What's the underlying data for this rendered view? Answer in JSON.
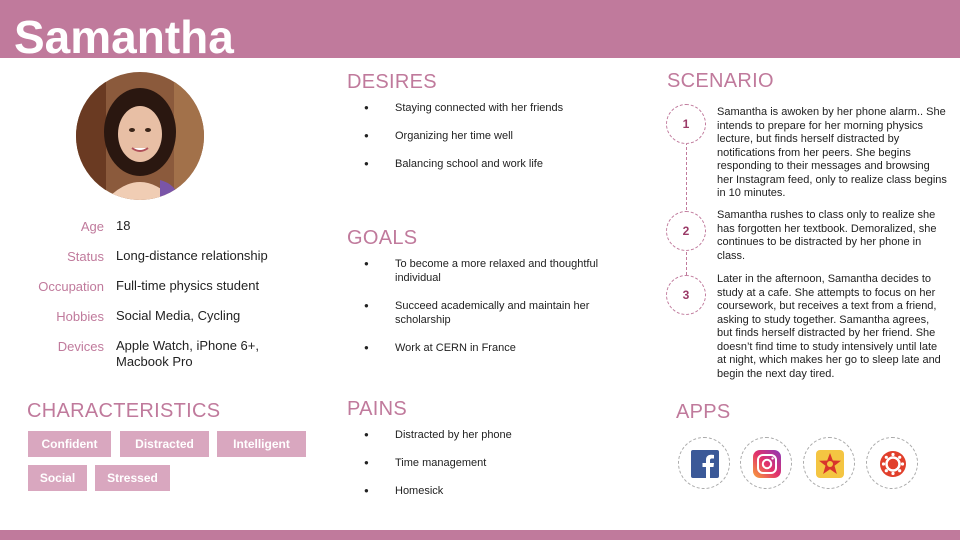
{
  "persona": {
    "name": "Samantha",
    "attributes": [
      {
        "label": "Age",
        "value": "18"
      },
      {
        "label": "Status",
        "value": "Long-distance relationship"
      },
      {
        "label": "Occupation",
        "value": "Full-time physics student"
      },
      {
        "label": "Hobbies",
        "value": "Social Media, Cycling"
      },
      {
        "label": "Devices",
        "value": "Apple Watch, iPhone 6+, Macbook Pro"
      }
    ]
  },
  "characteristics": {
    "title": "CHARACTERISTICS",
    "items": [
      "Confident",
      "Distracted",
      "Intelligent",
      "Social",
      "Stressed"
    ]
  },
  "desires": {
    "title": "DESIRES",
    "items": [
      "Staying connected with her friends",
      "Organizing her time well",
      "Balancing  school and work life"
    ]
  },
  "goals": {
    "title": "GOALS",
    "items": [
      "To become a more relaxed and thoughtful individual",
      "Succeed academically and maintain her scholarship",
      "Work at CERN in France"
    ]
  },
  "pains": {
    "title": "PAINS",
    "items": [
      "Distracted by her phone",
      "Time management",
      "Homesick"
    ]
  },
  "scenario": {
    "title": "SCENARIO",
    "steps": [
      {
        "number": "1",
        "text": "Samantha is awoken by her phone alarm.. She intends to prepare for her morning physics lecture, but finds herself distracted by notifications from her peers. She begins responding to their messages and browsing her Instagram feed, only to realize class begins in 10 minutes."
      },
      {
        "number": "2",
        "text": "Samantha rushes to class only to realize she has forgotten her textbook. Demoralized, she continues to be distracted by her phone in class."
      },
      {
        "number": "3",
        "text": "Later in the afternoon, Samantha decides to study at a cafe. She attempts to focus on her coursework, but receives a text from a friend, asking to study together. Samantha agrees, but finds herself distracted by her friend. She doesn’t find time to study intensively until late at night, which makes her go to sleep late  and begin the next day tired."
      }
    ]
  },
  "apps": {
    "title": "APPS",
    "items": [
      {
        "icon": "facebook-icon",
        "color": "#3b5998"
      },
      {
        "icon": "instagram-icon",
        "color": "#c13584"
      },
      {
        "icon": "star-app-icon",
        "color": "#e0a030"
      },
      {
        "icon": "canvas-icon",
        "color": "#e13f2b"
      }
    ]
  },
  "colors": {
    "accent": "#c07a9c",
    "chip": "#d9a7bf",
    "step_number": "#9a3a67"
  }
}
